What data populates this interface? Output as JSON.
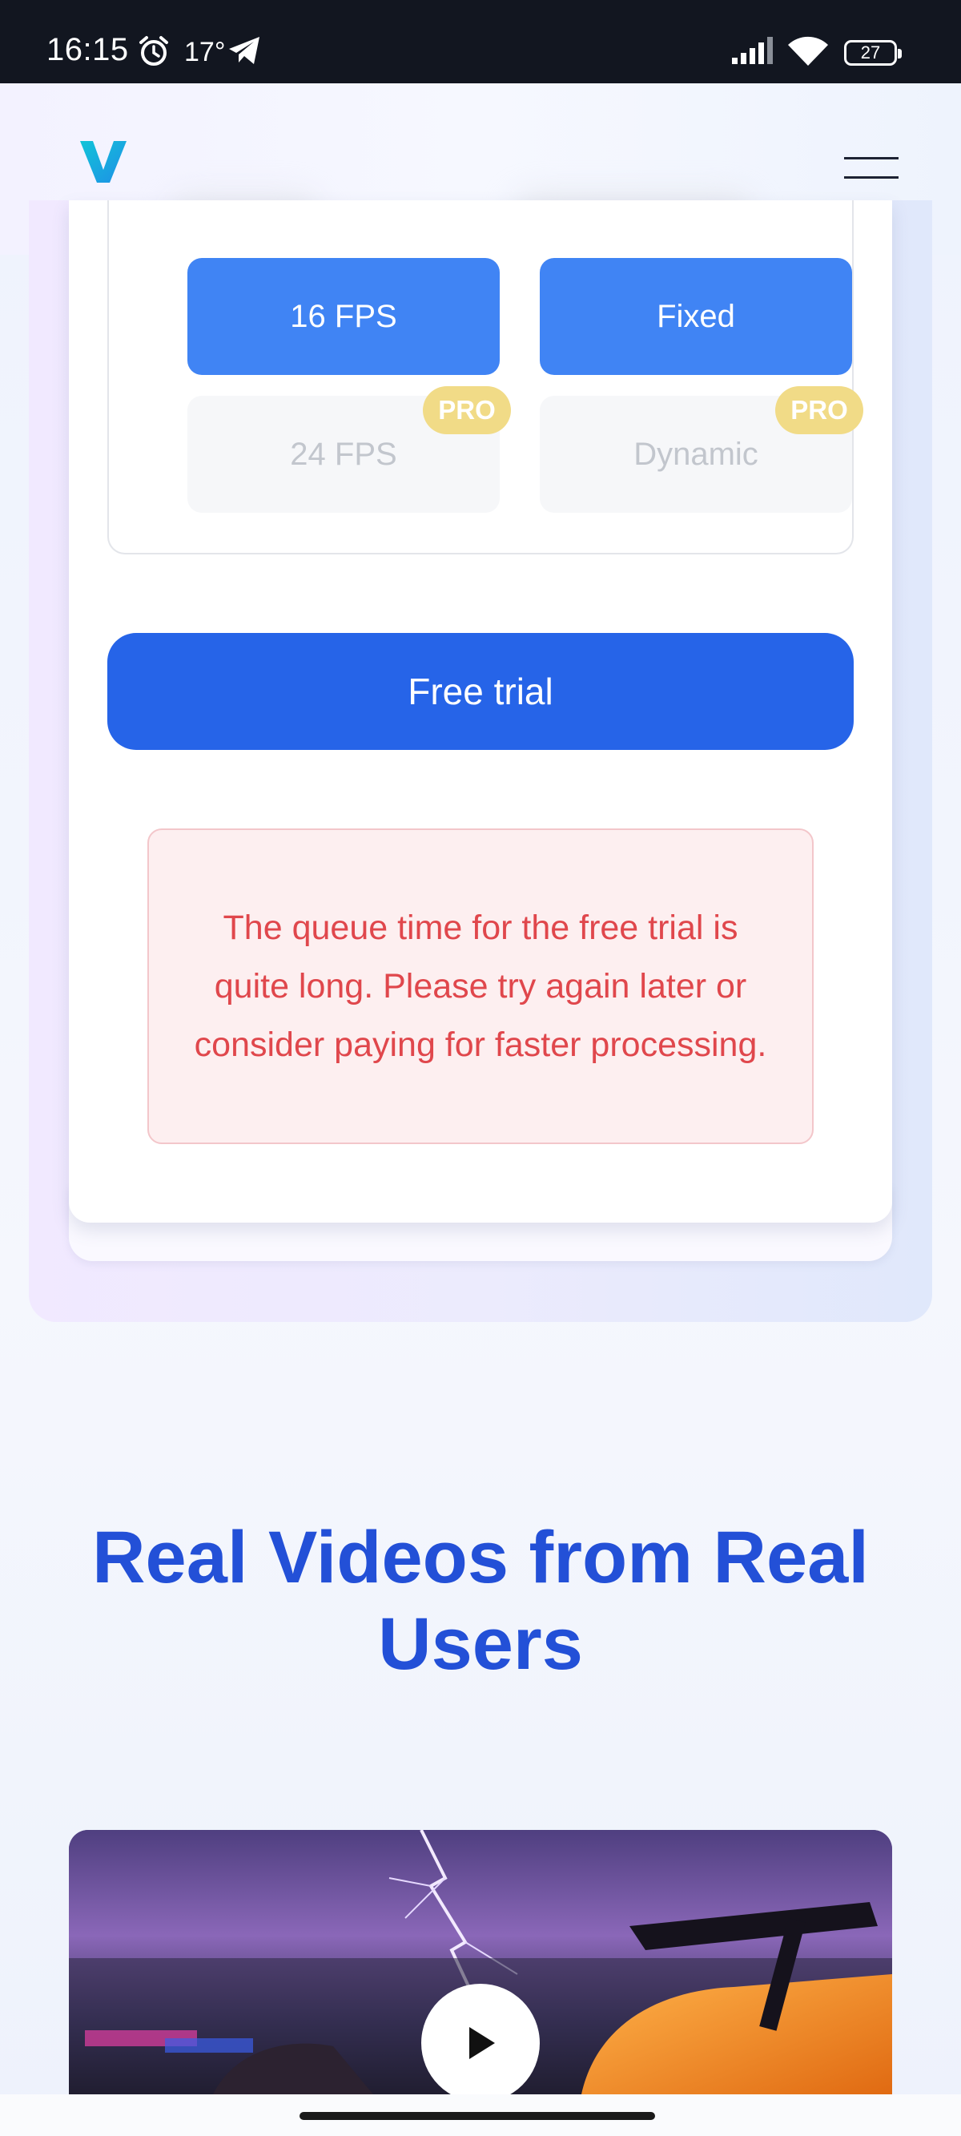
{
  "status_bar": {
    "time": "16:15",
    "temperature": "17°",
    "battery": "27"
  },
  "header": {
    "logo_letter": "V",
    "accent_color": "#18a8e0"
  },
  "options": {
    "fps": [
      {
        "label": "16 FPS",
        "selected": true,
        "pro": false
      },
      {
        "label": "24 FPS",
        "selected": false,
        "pro": true
      }
    ],
    "motion": [
      {
        "label": "Fixed",
        "selected": true,
        "pro": false
      },
      {
        "label": "Dynamic",
        "selected": false,
        "pro": true
      }
    ],
    "pro_badge": "PRO"
  },
  "free_trial_button": "Free trial",
  "queue_notice": "The queue time for the free trial is quite long. Please try again later or consider paying for faster processing.",
  "section": {
    "title": "Real Videos from Real Users"
  },
  "colors": {
    "primary": "#2664e8",
    "option_selected": "#4084f4",
    "pro_badge": "#f1db87",
    "notice_text": "#e0474c",
    "title": "#2350d7"
  }
}
